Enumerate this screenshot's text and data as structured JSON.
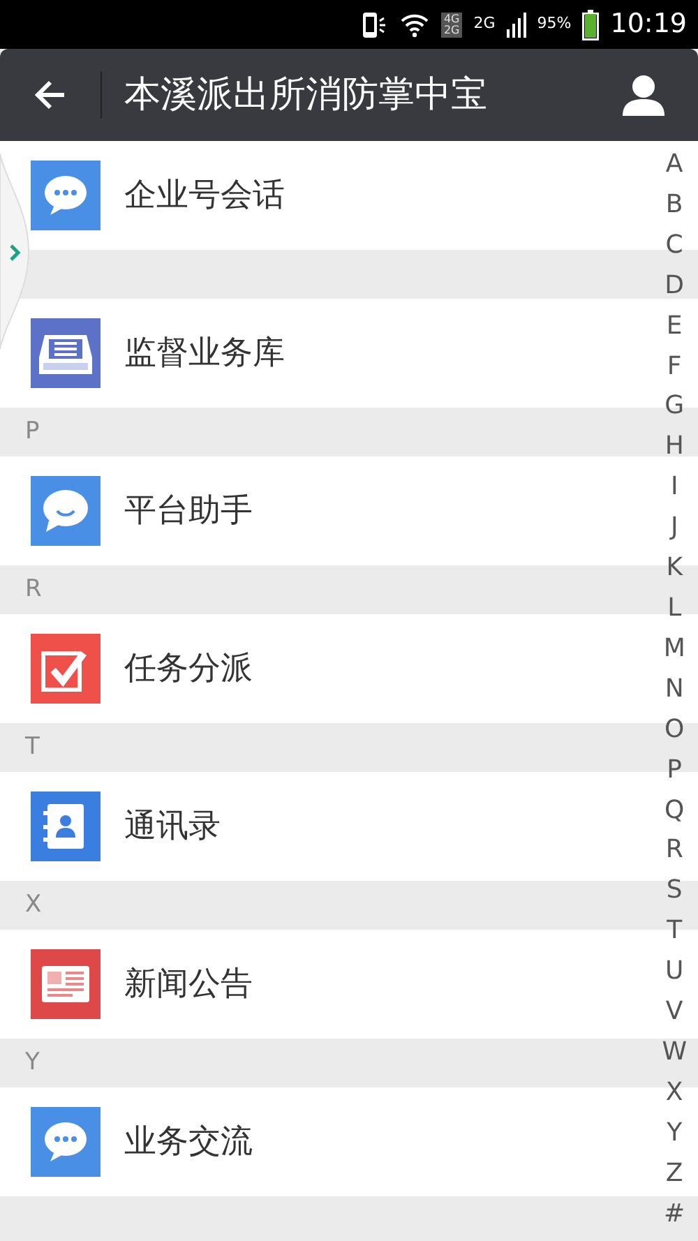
{
  "status_bar": {
    "network_1": "4G",
    "network_2": "2G",
    "network_3": "2G",
    "battery": "95%",
    "time": "10:19"
  },
  "toolbar": {
    "title": "本溪派出所消防掌中宝"
  },
  "entries": [
    {
      "kind": "item",
      "label": "企业号会话"
    },
    {
      "kind": "header"
    },
    {
      "kind": "item",
      "label": "监督业务库"
    },
    {
      "kind": "header",
      "label": "P"
    },
    {
      "kind": "item",
      "label": "平台助手"
    },
    {
      "kind": "header",
      "label": "R"
    },
    {
      "kind": "item",
      "label": "任务分派"
    },
    {
      "kind": "header",
      "label": "T"
    },
    {
      "kind": "item",
      "label": "通讯录"
    },
    {
      "kind": "header",
      "label": "X"
    },
    {
      "kind": "item",
      "label": "新闻公告"
    },
    {
      "kind": "header",
      "label": "Y"
    },
    {
      "kind": "item",
      "label": "业务交流"
    }
  ],
  "index_bar": [
    "A",
    "B",
    "C",
    "D",
    "E",
    "F",
    "G",
    "H",
    "I",
    "J",
    "K",
    "L",
    "M",
    "N",
    "O",
    "P",
    "Q",
    "R",
    "S",
    "T",
    "U",
    "V",
    "W",
    "X",
    "Y",
    "Z",
    "#"
  ]
}
